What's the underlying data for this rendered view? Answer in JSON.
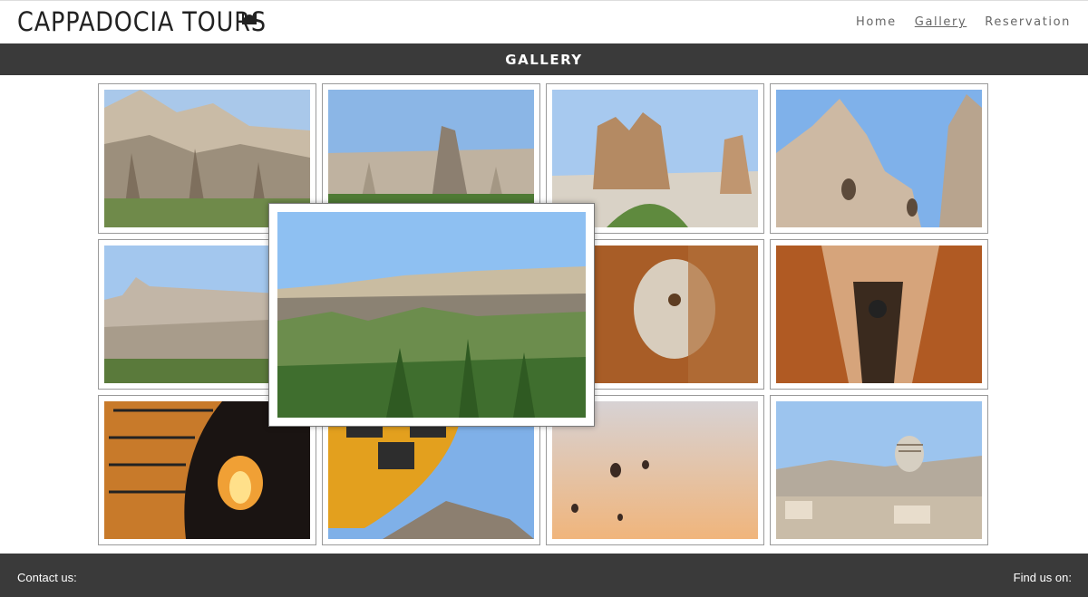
{
  "header": {
    "brand": "CAPPADOCIA TOURS",
    "logo_icon": "crescent-mosque-icon",
    "nav": [
      {
        "label": "Home"
      },
      {
        "label": "Gallery"
      },
      {
        "label": "Reservation"
      }
    ],
    "active_nav": "Gallery"
  },
  "band": {
    "title": "GALLERY"
  },
  "gallery": {
    "featured": {
      "subject": "Ihlara valley with green trees"
    },
    "thumbnails": [
      {
        "subject": "rock formations with green shrubs"
      },
      {
        "subject": "fairy chimneys valley"
      },
      {
        "subject": "camel-shaped rock"
      },
      {
        "subject": "cave dwellings in rock"
      },
      {
        "subject": "Uchisar castle view"
      },
      {
        "subject": "Ihlara valley (hidden)"
      },
      {
        "subject": "underground city millstone door"
      },
      {
        "subject": "underground city tunnel"
      },
      {
        "subject": "balloon inflation at night"
      },
      {
        "subject": "balloon over rocks"
      },
      {
        "subject": "balloons at sunrise"
      },
      {
        "subject": "balloon over town"
      }
    ]
  },
  "footer": {
    "contact_label": "Contact us:",
    "social_label": "Find us on:"
  }
}
